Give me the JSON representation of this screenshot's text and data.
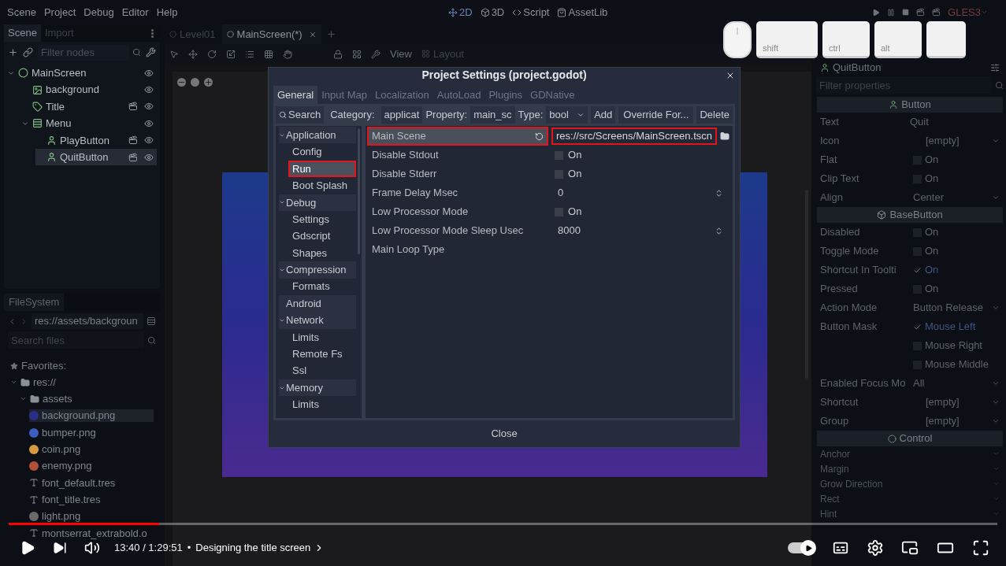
{
  "menu": [
    "Scene",
    "Project",
    "Debug",
    "Editor",
    "Help"
  ],
  "workspaces": [
    {
      "label": "2D",
      "kind": "canvas",
      "selected": true
    },
    {
      "label": "3D",
      "kind": "spatial",
      "selected": false
    },
    {
      "label": "Script",
      "kind": "script",
      "selected": false
    },
    {
      "label": "AssetLib",
      "kind": "assetlib",
      "selected": false
    }
  ],
  "renderer": "GLES3",
  "scene_dock": {
    "tabs": [
      {
        "label": "Scene",
        "selected": true
      },
      {
        "label": "Import",
        "selected": false
      }
    ],
    "filter_placeholder": "Filter nodes",
    "nodes": [
      {
        "name": "MainScreen",
        "kind": "control",
        "expanded": true,
        "selected": false,
        "clapper": false,
        "children": [
          {
            "name": "background",
            "kind": "texture",
            "selected": false,
            "clapper": false
          },
          {
            "name": "Title",
            "kind": "label",
            "selected": false,
            "clapper": true
          },
          {
            "name": "Menu",
            "kind": "vbox",
            "expanded": true,
            "selected": false,
            "clapper": false,
            "children": [
              {
                "name": "PlayButton",
                "kind": "button",
                "selected": false,
                "clapper": true
              },
              {
                "name": "QuitButton",
                "kind": "button",
                "selected": true,
                "clapper": true
              }
            ]
          }
        ]
      }
    ]
  },
  "filesystem": {
    "tab": "FileSystem",
    "path": "res://assets/backgroun",
    "search_placeholder": "Search files",
    "favorites": "Favorites:",
    "tree": [
      {
        "name": "res://",
        "kind": "folder",
        "expanded": true,
        "selected": false,
        "children": [
          {
            "name": "assets",
            "kind": "folder",
            "expanded": true,
            "selected": false,
            "children": [
              {
                "name": "background.png",
                "kind": "image",
                "color": "#2a2f8a",
                "selected": true
              },
              {
                "name": "bumper.png",
                "kind": "image",
                "color": "#3b5fc0",
                "selected": false
              },
              {
                "name": "coin.png",
                "kind": "image",
                "color": "#d89a3c",
                "selected": false
              },
              {
                "name": "enemy.png",
                "kind": "image",
                "color": "#b0503a",
                "selected": false
              },
              {
                "name": "font_default.tres",
                "kind": "font",
                "selected": false
              },
              {
                "name": "font_title.tres",
                "kind": "font",
                "selected": false
              },
              {
                "name": "light.png",
                "kind": "image",
                "color": "#6a6a6a",
                "selected": false
              },
              {
                "name": "montserrat_extrabold.o",
                "kind": "font",
                "selected": false
              }
            ]
          }
        ]
      }
    ]
  },
  "editor_tabs": [
    {
      "label": "Level01",
      "selected": false
    },
    {
      "label": "MainScreen(*)",
      "selected": true
    }
  ],
  "canvas_toolbar": {
    "view": "View",
    "layout": "Layout"
  },
  "dialog": {
    "title": "Project Settings (project.godot)",
    "tabs": [
      {
        "label": "General",
        "selected": true
      },
      {
        "label": "Input Map",
        "selected": false
      },
      {
        "label": "Localization",
        "selected": false
      },
      {
        "label": "AutoLoad",
        "selected": false
      },
      {
        "label": "Plugins",
        "selected": false
      },
      {
        "label": "GDNative",
        "selected": false
      }
    ],
    "toolbar": {
      "search": "Search",
      "category_label": "Category:",
      "category": "applicat",
      "property_label": "Property:",
      "property": "main_sc",
      "type_label": "Type:",
      "type": "bool",
      "add": "Add",
      "override": "Override For...",
      "delete": "Delete"
    },
    "sections": [
      {
        "label": "Application",
        "expanded": true,
        "children": [
          {
            "label": "Config",
            "selected": false,
            "highlighted": false
          },
          {
            "label": "Run",
            "selected": true,
            "highlighted": true
          },
          {
            "label": "Boot Splash",
            "selected": false,
            "highlighted": false
          }
        ]
      },
      {
        "label": "Debug",
        "expanded": true,
        "children": [
          {
            "label": "Settings",
            "selected": false,
            "highlighted": false
          },
          {
            "label": "Gdscript",
            "selected": false,
            "highlighted": false
          },
          {
            "label": "Shapes",
            "selected": false,
            "highlighted": false
          }
        ]
      },
      {
        "label": "Compression",
        "expanded": true,
        "children": [
          {
            "label": "Formats",
            "selected": false,
            "highlighted": false
          }
        ]
      },
      {
        "label": "Android"
      },
      {
        "label": "Network",
        "expanded": true,
        "children": [
          {
            "label": "Limits",
            "selected": false,
            "highlighted": false
          },
          {
            "label": "Remote Fs",
            "selected": false,
            "highlighted": false
          },
          {
            "label": "Ssl",
            "selected": false,
            "highlighted": false
          }
        ]
      },
      {
        "label": "Memory",
        "expanded": true,
        "children": [
          {
            "label": "Limits",
            "selected": false,
            "highlighted": false
          }
        ]
      }
    ],
    "properties": [
      {
        "name": "Main Scene",
        "kind": "file",
        "value": "res://src/Screens/MainScreen.tscn",
        "selected": true,
        "highlighted": true,
        "revertable": true
      },
      {
        "name": "Disable Stdout",
        "kind": "check",
        "label": "On",
        "checked": false,
        "selected": false,
        "highlighted": false,
        "revertable": false
      },
      {
        "name": "Disable Stderr",
        "kind": "check",
        "label": "On",
        "checked": false,
        "selected": false,
        "highlighted": false,
        "revertable": false
      },
      {
        "name": "Frame Delay Msec",
        "kind": "spin",
        "value": "0",
        "selected": false,
        "highlighted": false,
        "revertable": false
      },
      {
        "name": "Low Processor Mode",
        "kind": "check",
        "label": "On",
        "checked": false,
        "selected": false,
        "highlighted": false,
        "revertable": false
      },
      {
        "name": "Low Processor Mode Sleep Usec",
        "kind": "spin",
        "value": "8000",
        "selected": false,
        "highlighted": false,
        "revertable": false
      },
      {
        "name": "Main Loop Type",
        "kind": "empty",
        "selected": false,
        "highlighted": false,
        "revertable": false
      }
    ],
    "close": "Close"
  },
  "key_overlay": [
    {
      "kind": "mouse"
    },
    {
      "kind": "key",
      "label": "shift"
    },
    {
      "kind": "key",
      "label": "ctrl"
    },
    {
      "kind": "key",
      "label": "alt"
    },
    {
      "kind": "key"
    }
  ],
  "inspector": {
    "node": "QuitButton",
    "filter_placeholder": "Filter properties",
    "rows": [
      {
        "kind": "section",
        "title": "Button"
      },
      {
        "kind": "text",
        "name": "Text",
        "value": "Quit"
      },
      {
        "kind": "resource",
        "name": "Icon",
        "value": "[empty]"
      },
      {
        "kind": "check",
        "name": "Flat",
        "label": "On",
        "checked": false
      },
      {
        "kind": "check",
        "name": "Clip Text",
        "label": "On",
        "checked": false
      },
      {
        "kind": "enum",
        "name": "Align",
        "value": "Center"
      },
      {
        "kind": "section",
        "title": "BaseButton"
      },
      {
        "kind": "check",
        "name": "Disabled",
        "label": "On",
        "checked": false
      },
      {
        "kind": "check",
        "name": "Toggle Mode",
        "label": "On",
        "checked": false
      },
      {
        "kind": "check",
        "name": "Shortcut In Toolti",
        "label": "On",
        "checked": true
      },
      {
        "kind": "check",
        "name": "Pressed",
        "label": "On",
        "checked": false
      },
      {
        "kind": "enum",
        "name": "Action Mode",
        "value": "Button Release"
      },
      {
        "kind": "check",
        "name": "Button Mask",
        "label": "Mouse Left",
        "checked": true
      },
      {
        "kind": "check",
        "label": "Mouse Right",
        "checked": false
      },
      {
        "kind": "check",
        "label": "Mouse Middle",
        "checked": false
      },
      {
        "kind": "enum",
        "name": "Enabled Focus Mo",
        "value": "All"
      },
      {
        "kind": "resource",
        "name": "Shortcut",
        "value": "[empty]"
      },
      {
        "kind": "resource",
        "name": "Group",
        "value": "[empty]"
      },
      {
        "kind": "section",
        "title": "Control"
      },
      {
        "kind": "category",
        "name": "Anchor"
      },
      {
        "kind": "category",
        "name": "Margin"
      },
      {
        "kind": "category",
        "name": "Grow Direction"
      },
      {
        "kind": "category",
        "name": "Rect"
      },
      {
        "kind": "category",
        "name": "Hint"
      }
    ]
  },
  "player": {
    "progress": {
      "level": 0.152
    },
    "time": "13:40 / 1:29:51",
    "separator": "•",
    "chapter": "Designing the title screen",
    "autoplay": {
      "on": true
    }
  }
}
